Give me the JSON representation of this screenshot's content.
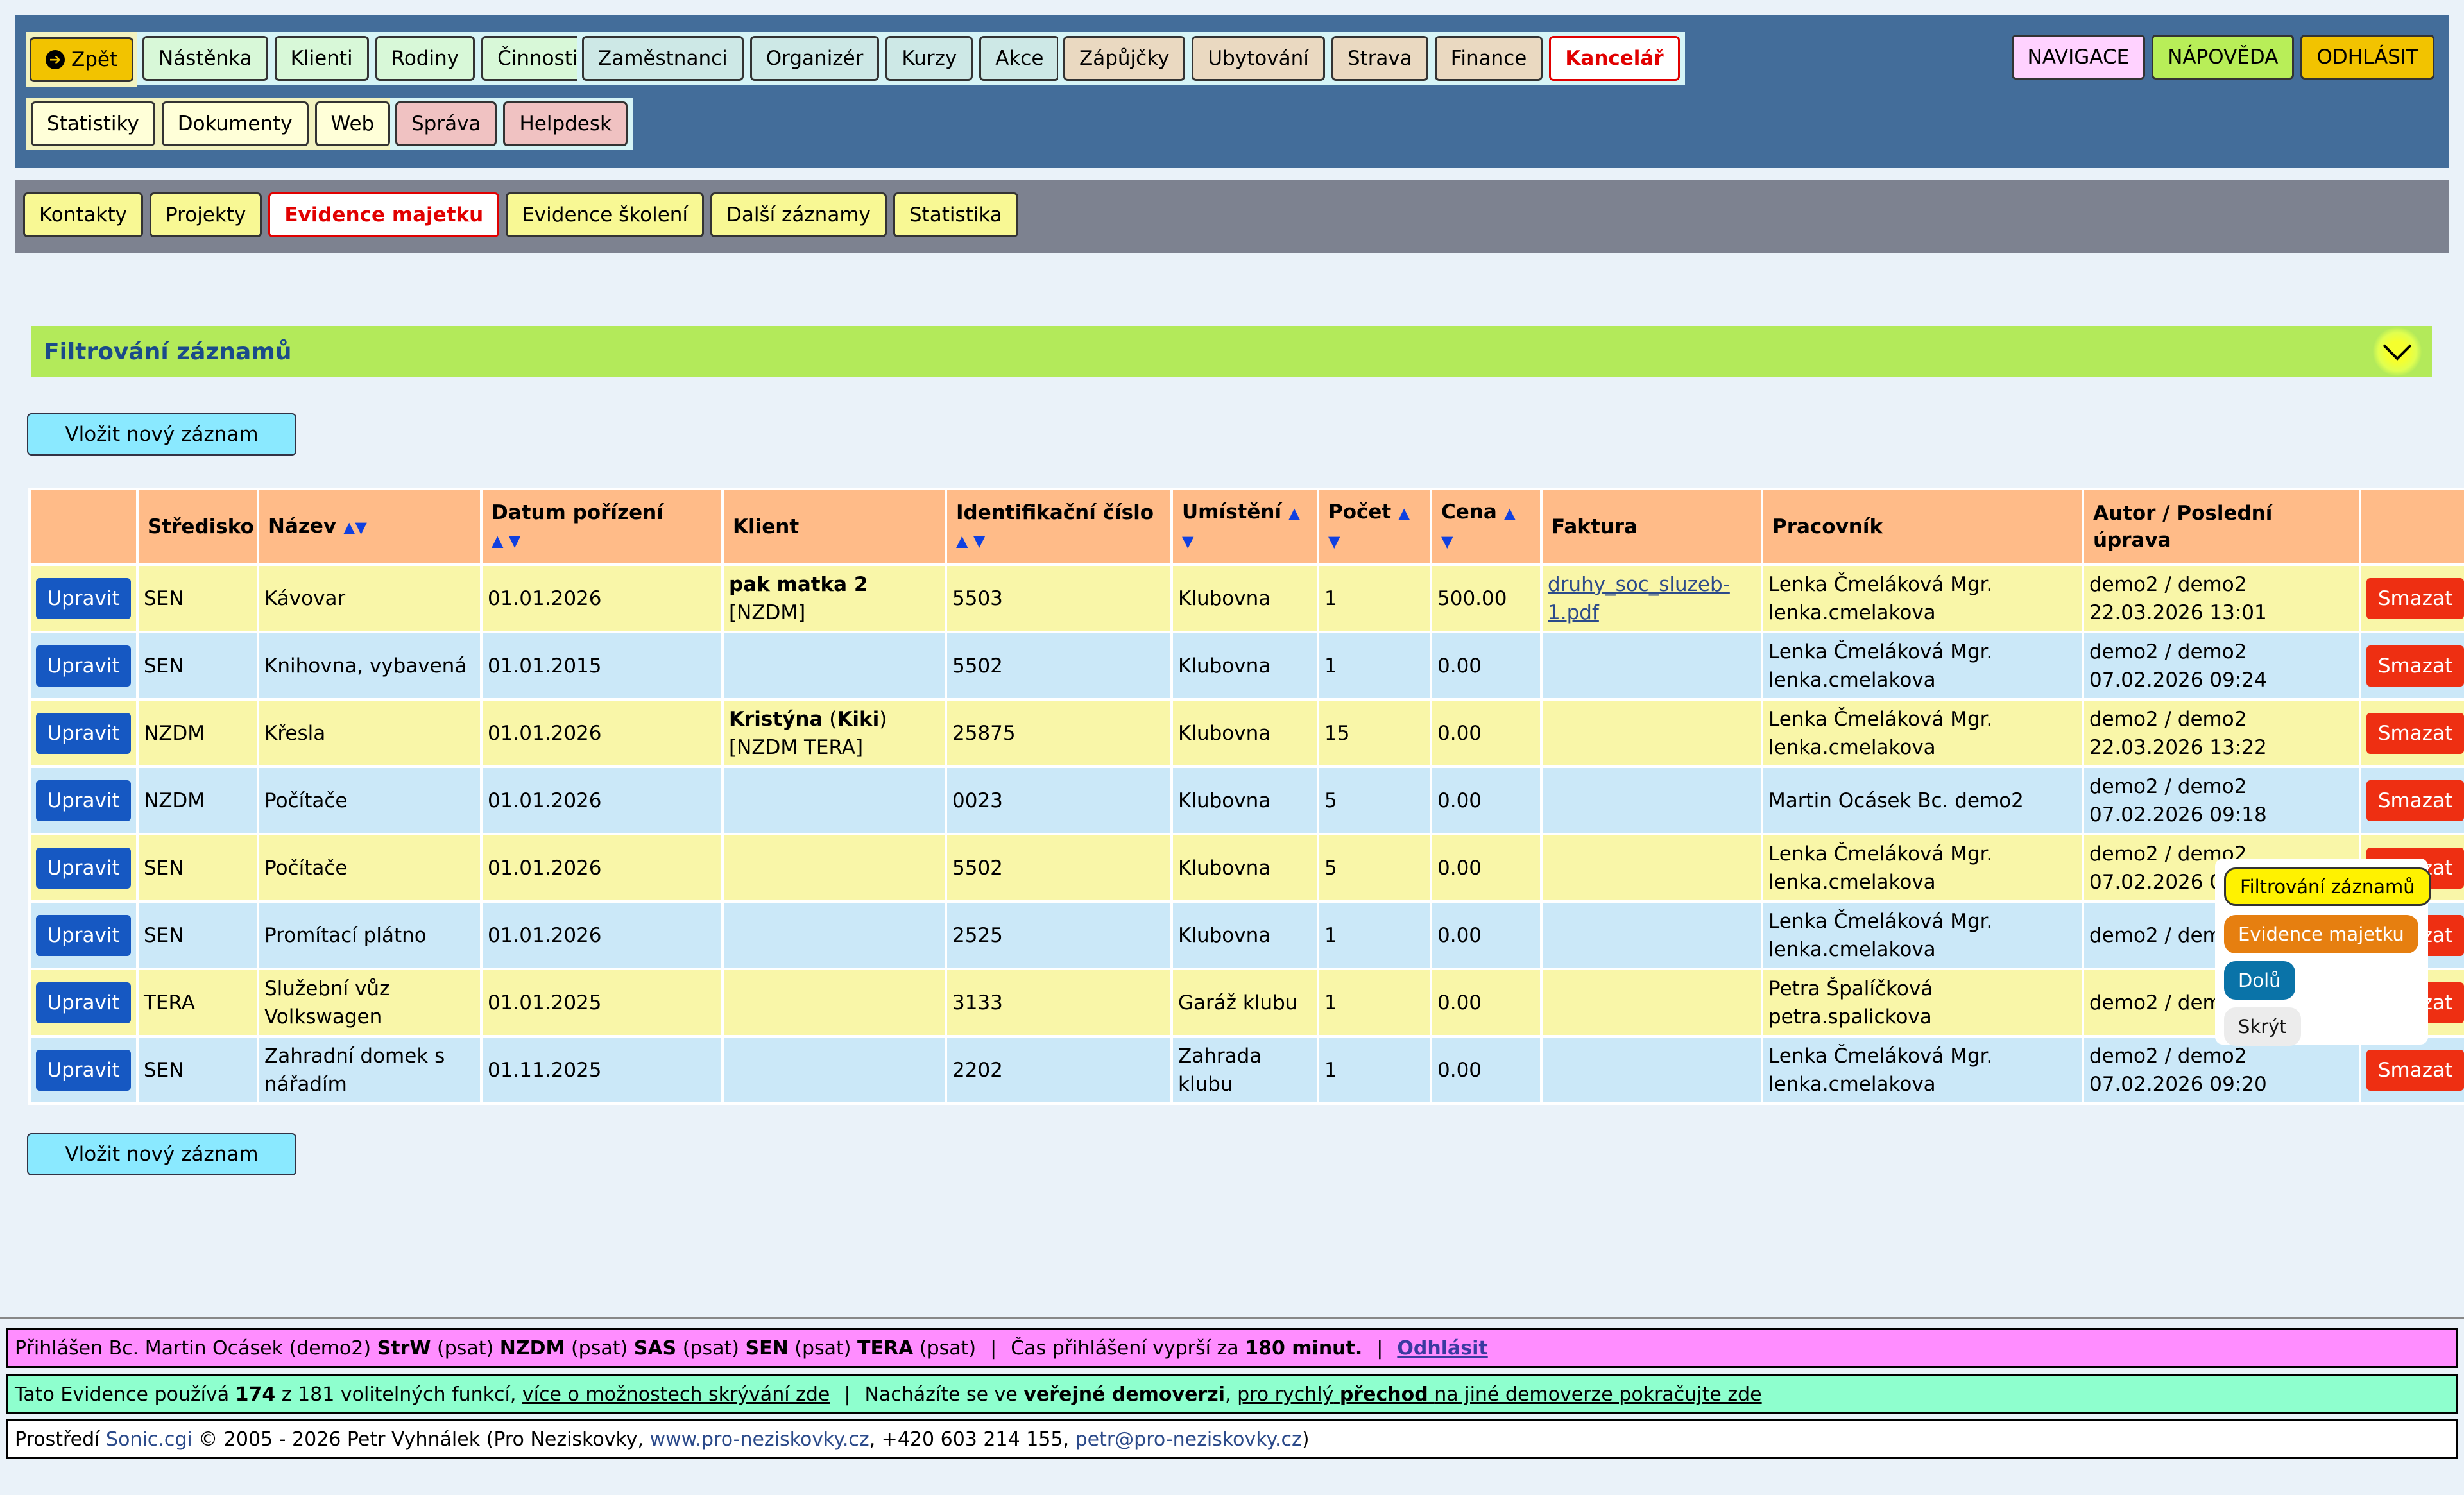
{
  "nav": {
    "back": "Zpět",
    "group1": [
      "Nástěnka",
      "Klienti",
      "Rodiny",
      "Činnosti"
    ],
    "group2": [
      "Zaměstnanci",
      "Organizér",
      "Kurzy",
      "Akce"
    ],
    "group3": [
      "Zápůjčky",
      "Ubytování",
      "Strava",
      "Finance"
    ],
    "office": "Kancelář",
    "group4": [
      "Statistiky",
      "Dokumenty",
      "Web"
    ],
    "group5": [
      "Správa",
      "Helpdesk"
    ],
    "navigace": "NAVIGACE",
    "napoveda": "NÁPOVĚDA",
    "odhlasit": "ODHLÁSIT"
  },
  "subnav": {
    "kontakty": "Kontakty",
    "projekty": "Projekty",
    "evidence_majetku": "Evidence majetku",
    "evidence_skoleni": "Evidence školení",
    "dalsi_zaznamy": "Další záznamy",
    "statistika": "Statistika"
  },
  "filter": {
    "title": "Filtrování záznamů"
  },
  "new_record": "Vložit nový záznam",
  "table": {
    "headers": {
      "stredisko": "Středisko",
      "nazev": "Název",
      "datum": "Datum pořízení",
      "klient": "Klient",
      "id": "Identifikační číslo",
      "umisteni": "Umístění",
      "pocet": "Počet",
      "cena": "Cena",
      "faktura": "Faktura",
      "pracovnik": "Pracovník",
      "autor": "Autor / Poslední úprava"
    },
    "edit_label": "Upravit",
    "delete_label": "Smazat",
    "rows": [
      {
        "stredisko": "SEN",
        "nazev": "Kávovar",
        "datum": "01.01.2026",
        "klient_bold": "pak matka 2",
        "klient_rest": " [NZDM]",
        "id": "5503",
        "umisteni": "Klubovna",
        "pocet": "1",
        "cena": "500.00",
        "faktura": "druhy_soc_sluzeb-1.pdf",
        "pracovnik": "Lenka Čmeláková Mgr. lenka.cmelakova",
        "autor": "demo2 / demo2 22.03.2026 13:01"
      },
      {
        "stredisko": "SEN",
        "nazev": "Knihovna, vybavená",
        "datum": "01.01.2015",
        "klient_bold": "",
        "klient_rest": "",
        "id": "5502",
        "umisteni": "Klubovna",
        "pocet": "1",
        "cena": "0.00",
        "faktura": "",
        "pracovnik": "Lenka Čmeláková Mgr. lenka.cmelakova",
        "autor": "demo2 / demo2 07.02.2026 09:24"
      },
      {
        "stredisko": "NZDM",
        "nazev": "Křesla",
        "datum": "01.01.2026",
        "klient_bold": "Kristýna",
        "klient_mid": " (",
        "klient_bold2": "Kiki",
        "klient_rest": ") [NZDM TERA]",
        "id": "25875",
        "umisteni": "Klubovna",
        "pocet": "15",
        "cena": "0.00",
        "faktura": "",
        "pracovnik": "Lenka Čmeláková Mgr. lenka.cmelakova",
        "autor": "demo2 / demo2 22.03.2026 13:22"
      },
      {
        "stredisko": "NZDM",
        "nazev": "Počítače",
        "datum": "01.01.2026",
        "klient_bold": "",
        "klient_rest": "",
        "id": "0023",
        "umisteni": "Klubovna",
        "pocet": "5",
        "cena": "0.00",
        "faktura": "",
        "pracovnik": "Martin Ocásek Bc. demo2",
        "autor": "demo2 / demo2 07.02.2026 09:18"
      },
      {
        "stredisko": "SEN",
        "nazev": "Počítače",
        "datum": "01.01.2026",
        "klient_bold": "",
        "klient_rest": "",
        "id": "5502",
        "umisteni": "Klubovna",
        "pocet": "5",
        "cena": "0.00",
        "faktura": "",
        "pracovnik": "Lenka Čmeláková Mgr. lenka.cmelakova",
        "autor": "demo2 / demo2 07.02.2026 09:19"
      },
      {
        "stredisko": "SEN",
        "nazev": "Promítací plátno",
        "datum": "01.01.2026",
        "klient_bold": "",
        "klient_rest": "",
        "id": "2525",
        "umisteni": "Klubovna",
        "pocet": "1",
        "cena": "0.00",
        "faktura": "",
        "pracovnik": "Lenka Čmeláková Mgr. lenka.cmelakova",
        "autor": "demo2 / demo2 0 09:18"
      },
      {
        "stredisko": "TERA",
        "nazev": "Služební vůz Volkswagen",
        "datum": "01.01.2025",
        "klient_bold": "",
        "klient_rest": "",
        "id": "3133",
        "umisteni": "Garáž klubu",
        "pocet": "1",
        "cena": "0.00",
        "faktura": "",
        "pracovnik": "Petra Špalíčková petra.spalickova",
        "autor": "demo2 / demo2 0 09:25"
      },
      {
        "stredisko": "SEN",
        "nazev": "Zahradní domek s nářadím",
        "datum": "01.11.2025",
        "klient_bold": "",
        "klient_rest": "",
        "id": "2202",
        "umisteni": "Zahrada klubu",
        "pocet": "1",
        "cena": "0.00",
        "faktura": "",
        "pracovnik": "Lenka Čmeláková Mgr. lenka.cmelakova",
        "autor": "demo2 / demo2 07.02.2026 09:20"
      }
    ]
  },
  "floating": {
    "filtrovani": "Filtrování záznamů",
    "evidence": "Evidence majetku",
    "dolu": "Dolů",
    "skryt": "Skrýt"
  },
  "status": {
    "login_prefix": "Přihlášen Bc. Martin Ocásek (demo2)",
    "roles": [
      {
        "code": "StrW",
        "mode": "(psat)"
      },
      {
        "code": "NZDM",
        "mode": "(psat)"
      },
      {
        "code": "SAS",
        "mode": "(psat)"
      },
      {
        "code": "SEN",
        "mode": "(psat)"
      },
      {
        "code": "TERA",
        "mode": "(psat)"
      }
    ],
    "session_prefix": "Čas přihlášení vyprší za",
    "session_time": "180 minut.",
    "logout": "Odhlásit",
    "features_prefix": "Tato Evidence používá",
    "features_count": "174",
    "features_rest": "z 181 volitelných funkcí,",
    "features_link": "více o možnostech skrývání zde",
    "demo_prefix": "Nacházíte se ve",
    "demo_bold": "veřejné demoverzi",
    "demo_link_a": "pro rychlý",
    "demo_link_b": "přechod",
    "demo_link_c": "na jiné demoverze pokračujte zde",
    "footer_prefix": "Prostředí",
    "footer_env": "Sonic.cgi",
    "footer_copy": "© 2005 - 2026 Petr Vyhnálek (Pro Neziskovky,",
    "footer_web": "www.pro-neziskovky.cz",
    "footer_phone": ", +420 603 214 155,",
    "footer_email": "petr@pro-neziskovky.cz",
    "footer_end": ")"
  }
}
